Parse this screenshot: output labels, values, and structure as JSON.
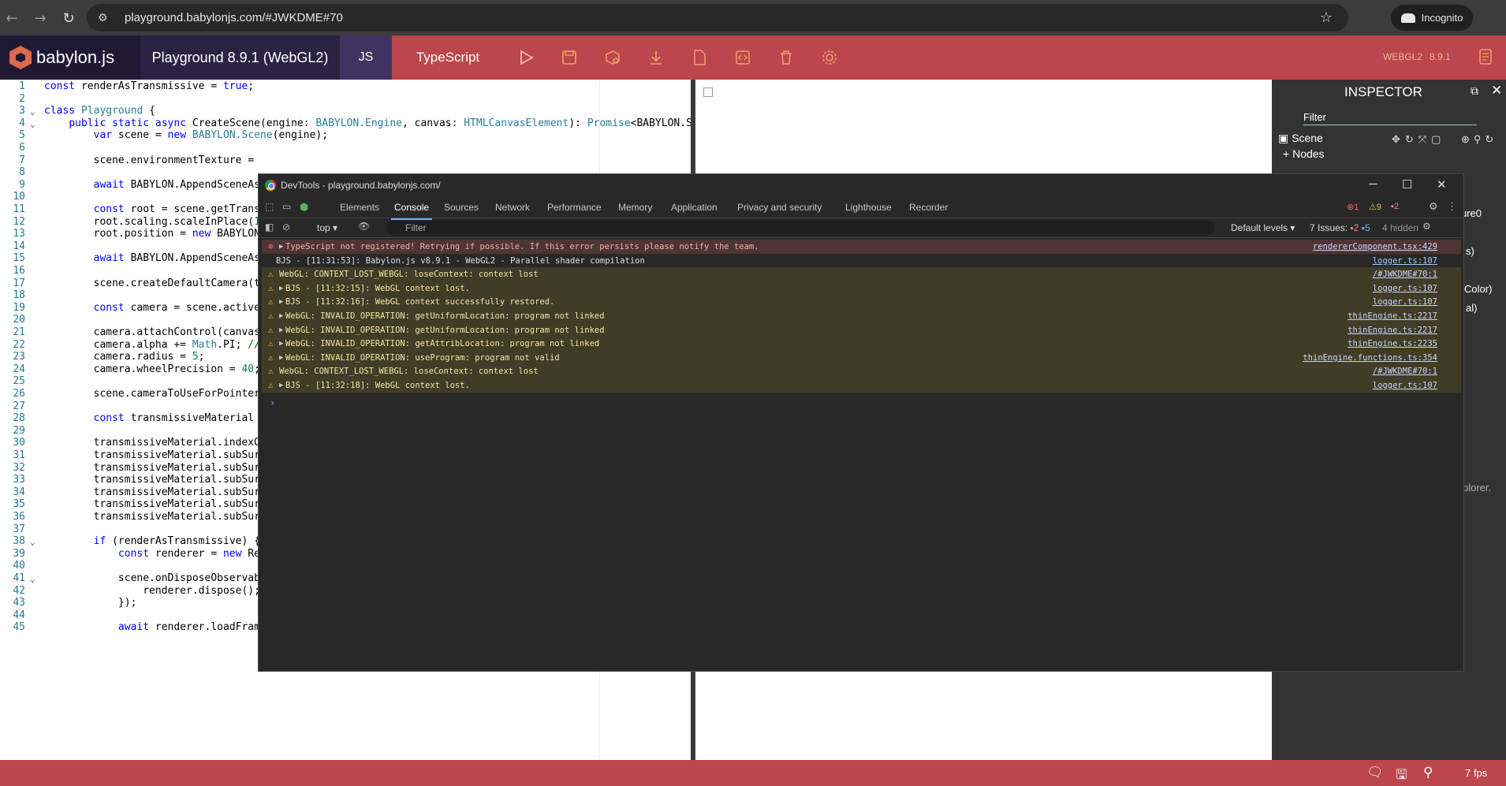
{
  "browser": {
    "url": "playground.babylonjs.com/#JWKDME#70",
    "incognito_label": "Incognito"
  },
  "header": {
    "brand": "babylon.js",
    "version": "Playground 8.9.1 (WebGL2)",
    "lang_js": "JS",
    "lang_ts": "TypeScript",
    "webgl_label": "WEBGL2",
    "version_small": "8.9.1",
    "toolbar_icons": [
      "play-icon",
      "save-icon",
      "inspector-icon",
      "download-icon",
      "new-icon",
      "clear-icon",
      "delete-icon",
      "settings-icon"
    ]
  },
  "editor": {
    "lines": [
      {
        "n": "1",
        "t": "const renderAsTransmissive = true;"
      },
      {
        "n": "2",
        "t": ""
      },
      {
        "n": "3",
        "t": "class Playground {"
      },
      {
        "n": "4",
        "t": "    public static async CreateScene(engine: BABYLON.Engine, canvas: HTMLCanvasElement): Promise<BABYLON.Sce"
      },
      {
        "n": "5",
        "t": "        var scene = new BABYLON.Scene(engine);"
      },
      {
        "n": "6",
        "t": ""
      },
      {
        "n": "7",
        "t": "        scene.environmentTexture ="
      },
      {
        "n": "8",
        "t": ""
      },
      {
        "n": "9",
        "t": "        await BABYLON.AppendSceneAs"
      },
      {
        "n": "10",
        "t": ""
      },
      {
        "n": "11",
        "t": "        const root = scene.getTrans"
      },
      {
        "n": "12",
        "t": "        root.scaling.scaleInPlace(1"
      },
      {
        "n": "13",
        "t": "        root.position = new BABYLON"
      },
      {
        "n": "14",
        "t": ""
      },
      {
        "n": "15",
        "t": "        await BABYLON.AppendSceneAs"
      },
      {
        "n": "16",
        "t": ""
      },
      {
        "n": "17",
        "t": "        scene.createDefaultCamera(t"
      },
      {
        "n": "18",
        "t": ""
      },
      {
        "n": "19",
        "t": "        const camera = scene.active"
      },
      {
        "n": "20",
        "t": ""
      },
      {
        "n": "21",
        "t": "        camera.attachControl(canvas"
      },
      {
        "n": "22",
        "t": "        camera.alpha += Math.PI; //"
      },
      {
        "n": "23",
        "t": "        camera.radius = 5;"
      },
      {
        "n": "24",
        "t": "        camera.wheelPrecision = 40;"
      },
      {
        "n": "25",
        "t": ""
      },
      {
        "n": "26",
        "t": "        scene.cameraToUseForPointer"
      },
      {
        "n": "27",
        "t": ""
      },
      {
        "n": "28",
        "t": "        const transmissiveMaterial"
      },
      {
        "n": "29",
        "t": ""
      },
      {
        "n": "30",
        "t": "        transmissiveMaterial.indexO"
      },
      {
        "n": "31",
        "t": "        transmissiveMaterial.subSur"
      },
      {
        "n": "32",
        "t": "        transmissiveMaterial.subSur"
      },
      {
        "n": "33",
        "t": "        transmissiveMaterial.subSur"
      },
      {
        "n": "34",
        "t": "        transmissiveMaterial.subSur"
      },
      {
        "n": "35",
        "t": "        transmissiveMaterial.subSur"
      },
      {
        "n": "36",
        "t": "        transmissiveMaterial.subSur"
      },
      {
        "n": "37",
        "t": ""
      },
      {
        "n": "38",
        "t": "        if (renderAsTransmissive) {"
      },
      {
        "n": "39",
        "t": "            const renderer = new Re"
      },
      {
        "n": "40",
        "t": ""
      },
      {
        "n": "41",
        "t": "            scene.onDisposeObservable.add(() => {"
      },
      {
        "n": "42",
        "t": "                renderer.dispose();"
      },
      {
        "n": "43",
        "t": "            });"
      },
      {
        "n": "44",
        "t": ""
      },
      {
        "n": "45",
        "t": "            await renderer.loadFrameGraphAsync();"
      }
    ]
  },
  "inspector": {
    "title": "INSPECTOR",
    "filter_placeholder": "Filter",
    "scene_label": "Scene",
    "nodes_label": "Nodes",
    "side_texts": [
      "ure0",
      "s)",
      "Color)",
      "al)",
      "plorer."
    ]
  },
  "devtools": {
    "title": "DevTools - playground.babylonjs.com/",
    "tabs": [
      "Elements",
      "Console",
      "Sources",
      "Network",
      "Performance",
      "Memory",
      "Application",
      "Privacy and security",
      "Lighthouse",
      "Recorder"
    ],
    "active_tab": "Console",
    "badges": {
      "errors": "1",
      "warnings": "9",
      "issues": "2"
    },
    "toolbar": {
      "context": "top",
      "filter_placeholder": "Filter",
      "levels": "Default levels",
      "issues_label": "7 Issues:",
      "issues_err": "2",
      "issues_info": "5",
      "hidden": "4 hidden"
    },
    "messages": [
      {
        "type": "err",
        "caret": true,
        "text": "TypeScript not registered! Retrying if possible. If this error persists please notify the team.",
        "src": "rendererComponent.tsx:429"
      },
      {
        "type": "info",
        "caret": false,
        "text": "BJS - [11:31:53]: Babylon.js v8.9.1 - WebGL2 - Parallel shader compilation",
        "src": "logger.ts:107"
      },
      {
        "type": "warn",
        "caret": false,
        "text": "WebGL: CONTEXT_LOST_WEBGL: loseContext: context lost",
        "src": "/#JWKDME#70:1"
      },
      {
        "type": "warn",
        "caret": true,
        "text": "BJS - [11:32:15]: WebGL context lost.",
        "src": "logger.ts:107"
      },
      {
        "type": "warn",
        "caret": true,
        "text": "BJS - [11:32:16]: WebGL context successfully restored.",
        "src": "logger.ts:107"
      },
      {
        "type": "warn",
        "caret": true,
        "text": "WebGL: INVALID_OPERATION: getUniformLocation: program not linked",
        "src": "thinEngine.ts:2217"
      },
      {
        "type": "warn",
        "caret": true,
        "text": "WebGL: INVALID_OPERATION: getUniformLocation: program not linked",
        "src": "thinEngine.ts:2217"
      },
      {
        "type": "warn",
        "caret": true,
        "text": "WebGL: INVALID_OPERATION: getAttribLocation: program not linked",
        "src": "thinEngine.ts:2235"
      },
      {
        "type": "warn",
        "caret": true,
        "text": "WebGL: INVALID_OPERATION: useProgram: program not valid",
        "src": "thinEngine.functions.ts:354"
      },
      {
        "type": "warn",
        "caret": false,
        "text": "WebGL: CONTEXT_LOST_WEBGL: loseContext: context lost",
        "src": "/#JWKDME#70:1"
      },
      {
        "type": "warn",
        "caret": true,
        "text": "BJS - [11:32:18]: WebGL context lost.",
        "src": "logger.ts:107"
      }
    ]
  },
  "status": {
    "fps": "7 fps"
  }
}
